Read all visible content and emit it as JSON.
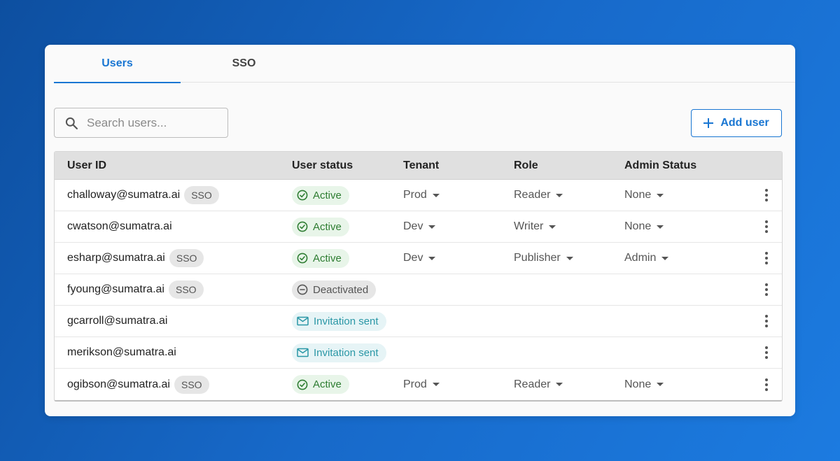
{
  "tabs": [
    {
      "label": "Users",
      "active": true
    },
    {
      "label": "SSO",
      "active": false
    }
  ],
  "search": {
    "placeholder": "Search users...",
    "value": ""
  },
  "add_button": {
    "label": "Add user"
  },
  "table": {
    "headers": [
      "User ID",
      "User status",
      "Tenant",
      "Role",
      "Admin Status"
    ],
    "rows": [
      {
        "user": "challoway@sumatra.ai",
        "sso": "SSO",
        "status": "Active",
        "status_type": "active",
        "tenant": "Prod",
        "role": "Reader",
        "admin": "None"
      },
      {
        "user": "cwatson@sumatra.ai",
        "sso": "",
        "status": "Active",
        "status_type": "active",
        "tenant": "Dev",
        "role": "Writer",
        "admin": "None"
      },
      {
        "user": "esharp@sumatra.ai",
        "sso": "SSO",
        "status": "Active",
        "status_type": "active",
        "tenant": "Dev",
        "role": "Publisher",
        "admin": "Admin"
      },
      {
        "user": "fyoung@sumatra.ai",
        "sso": "SSO",
        "status": "Deactivated",
        "status_type": "deactivated",
        "tenant": "",
        "role": "",
        "admin": ""
      },
      {
        "user": "gcarroll@sumatra.ai",
        "sso": "",
        "status": "Invitation sent",
        "status_type": "invited",
        "tenant": "",
        "role": "",
        "admin": ""
      },
      {
        "user": "merikson@sumatra.ai",
        "sso": "",
        "status": "Invitation sent",
        "status_type": "invited",
        "tenant": "",
        "role": "",
        "admin": ""
      },
      {
        "user": "ogibson@sumatra.ai",
        "sso": "SSO",
        "status": "Active",
        "status_type": "active",
        "tenant": "Prod",
        "role": "Reader",
        "admin": "None"
      }
    ]
  },
  "icons": {
    "search": "search-icon",
    "add": "plus-icon",
    "active": "check-circle-icon",
    "deactivated": "minus-circle-icon",
    "invited": "mail-icon",
    "dropdown": "caret-down-icon",
    "row_menu": "more-vert-icon"
  },
  "colors": {
    "accent": "#1976d2",
    "active_bg": "#e8f5e9",
    "active_fg": "#2e7d32",
    "invite_bg": "#e6f4f6",
    "invite_fg": "#2a97a6",
    "deactivated_bg": "#e6e6e6"
  }
}
